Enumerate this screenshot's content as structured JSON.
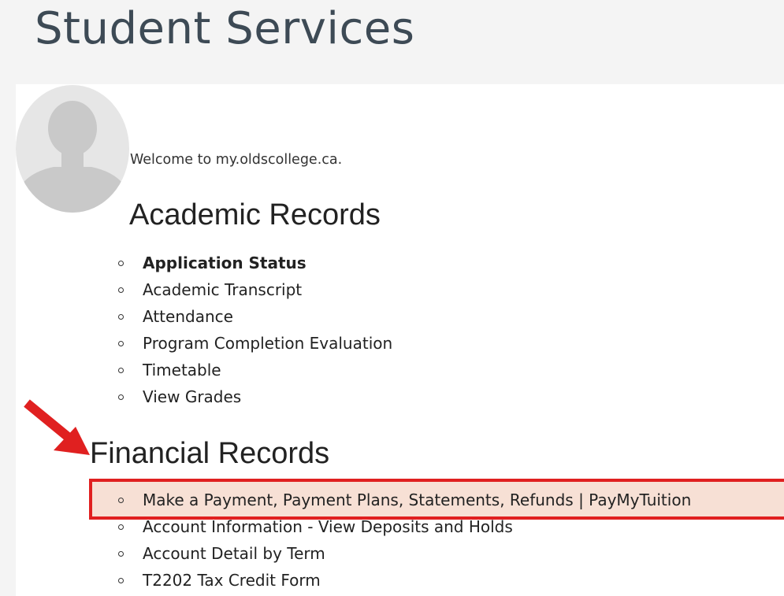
{
  "header": {
    "title": "Student Services"
  },
  "welcome": {
    "text": "Welcome to my.oldscollege.ca."
  },
  "academic": {
    "heading": "Academic Records",
    "items": [
      {
        "label": "Application Status",
        "bold": true
      },
      {
        "label": "Academic Transcript"
      },
      {
        "label": "Attendance"
      },
      {
        "label": "Program Completion Evaluation"
      },
      {
        "label": "Timetable"
      },
      {
        "label": "View Grades"
      }
    ]
  },
  "financial": {
    "heading": "Financial Records",
    "items": [
      {
        "label": "Make a Payment, Payment Plans, Statements, Refunds | PayMyTuition",
        "highlighted": true
      },
      {
        "label": "Account Information - View Deposits and Holds"
      },
      {
        "label": "Account Detail by Term"
      },
      {
        "label": "T2202 Tax Credit Form"
      }
    ]
  },
  "annotation": {
    "arrow_color": "#e02020",
    "highlight_color": "#e02020",
    "highlight_fill": "#f7e0d5"
  },
  "icons": {
    "avatar": "user-silhouette-icon",
    "arrow": "red-arrow-icon",
    "bullet": "circle-bullet-icon"
  }
}
